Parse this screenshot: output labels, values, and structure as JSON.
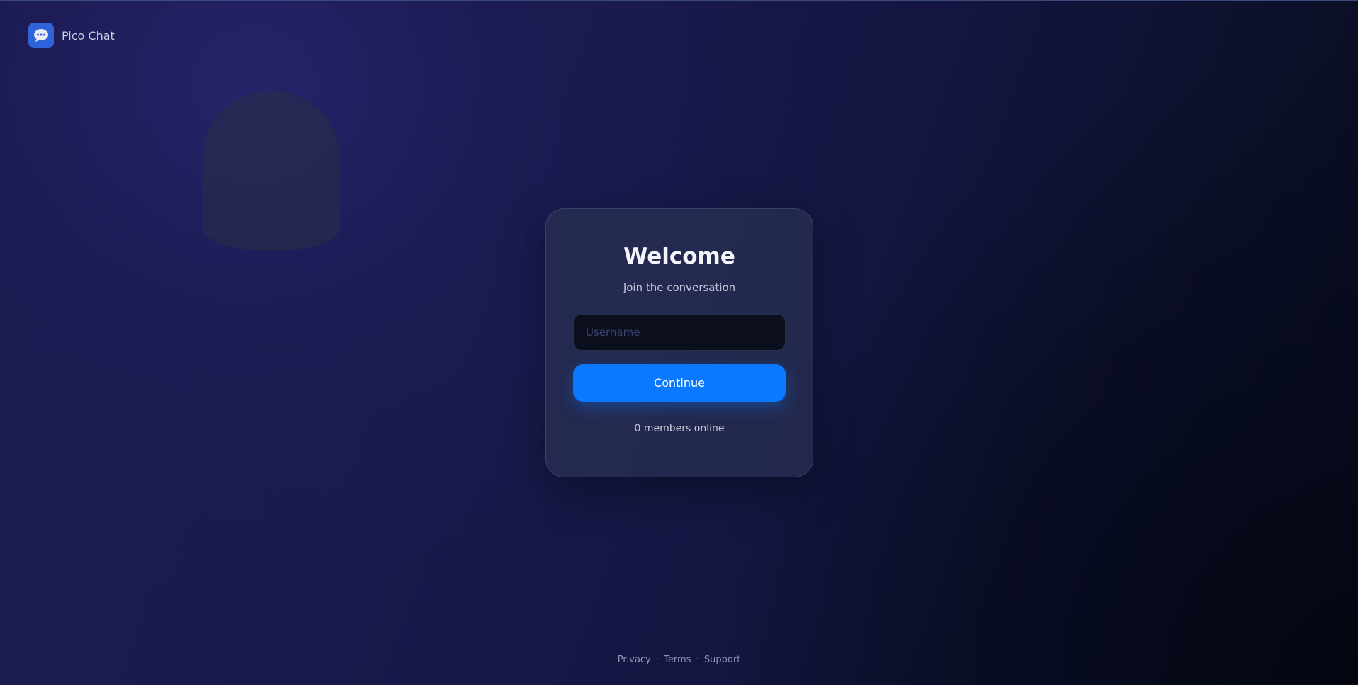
{
  "brand": {
    "icon": "chat-bubble-icon",
    "name": "Pico Chat",
    "icon_color": "#2f63d9"
  },
  "login": {
    "title": "Welcome",
    "subtitle": "Join the conversation",
    "username_placeholder": "Username",
    "username_value": "",
    "button_label": "Continue",
    "button_color": "#0a78ff",
    "members_online": "0 members online"
  },
  "footer": {
    "links": [
      "Privacy",
      "Terms",
      "Support"
    ],
    "separator": "·"
  }
}
